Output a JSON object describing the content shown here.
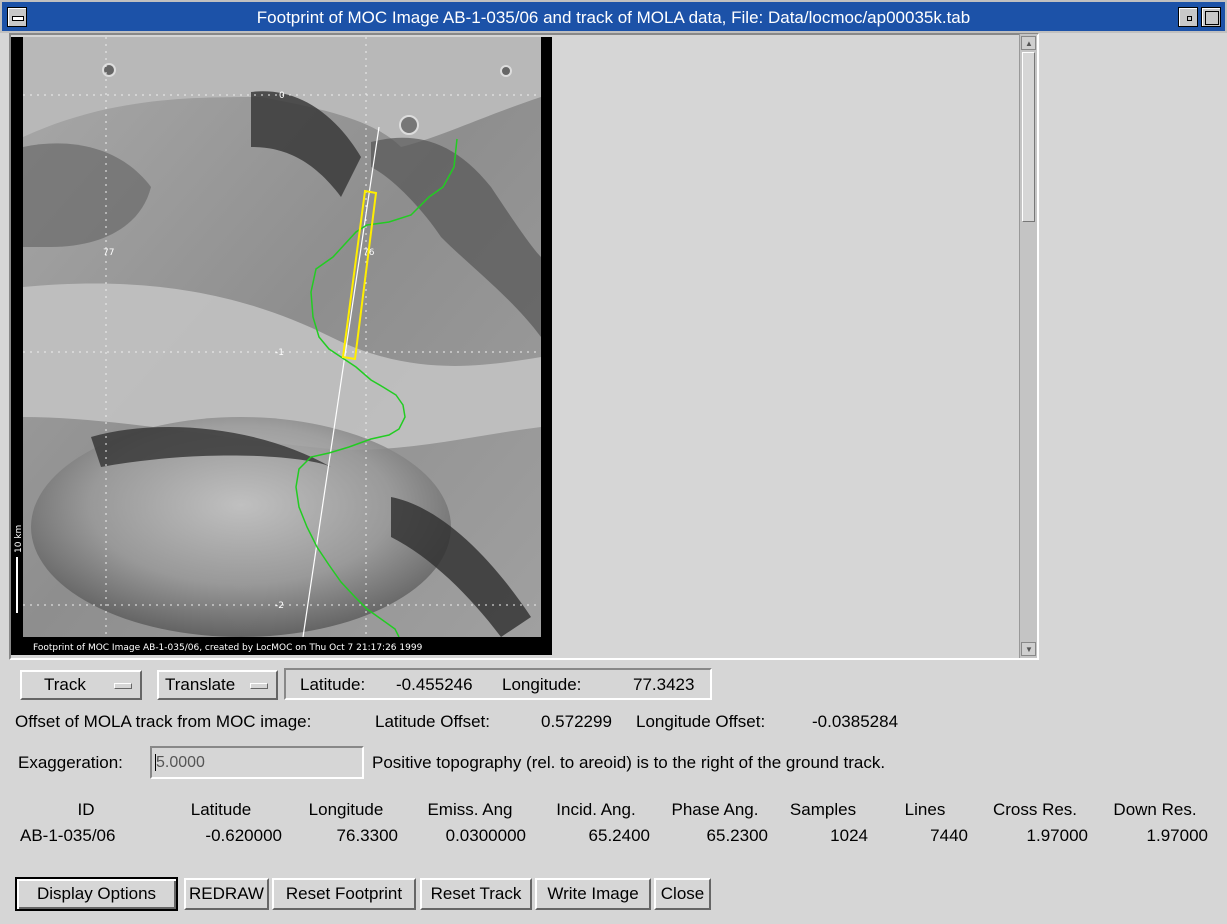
{
  "window": {
    "title": "Footprint of MOC Image AB-1-035/06 and track of MOLA data, File: Data/locmoc/ap00035k.tab"
  },
  "image": {
    "caption": "Footprint of MOC Image AB-1-035/06, created by LocMOC on Thu Oct  7 21:17:26 1999",
    "lat_labels": [
      "0",
      "-1",
      "-2"
    ],
    "lon_label_left": "77",
    "lon_label_mid": "76",
    "scale_label": "10 km",
    "colors": {
      "track": "#ffffff",
      "profile": "#22cc22",
      "footprint": "#ffee00"
    }
  },
  "controls": {
    "track_menu": "Track",
    "translate_menu": "Translate",
    "latitude_label": "Latitude:",
    "latitude_value": "-0.455246",
    "longitude_label": "Longitude:",
    "longitude_value": "77.3423"
  },
  "offset": {
    "label": "Offset of MOLA track from MOC image:",
    "lat_label": "Latitude Offset:",
    "lat_value": "0.572299",
    "lon_label": "Longitude Offset:",
    "lon_value": "-0.0385284"
  },
  "exaggeration": {
    "label": "Exaggeration:",
    "value": "5.0000",
    "note": "Positive topography (rel. to areoid) is to the right of the ground track."
  },
  "table": {
    "headers": [
      "ID",
      "Latitude",
      "Longitude",
      "Emiss. Ang",
      "Incid. Ang.",
      "Phase Ang.",
      "Samples",
      "Lines",
      "Cross Res.",
      "Down Res."
    ],
    "row": [
      "AB-1-035/06",
      "-0.620000",
      "76.3300",
      "0.0300000",
      "65.2400",
      "65.2300",
      "1024",
      "7440",
      "1.97000",
      "1.97000"
    ]
  },
  "buttons": {
    "display_options": "Display Options",
    "redraw": "REDRAW",
    "reset_footprint": "Reset Footprint",
    "reset_track": "Reset Track",
    "write_image": "Write Image",
    "close": "Close"
  }
}
